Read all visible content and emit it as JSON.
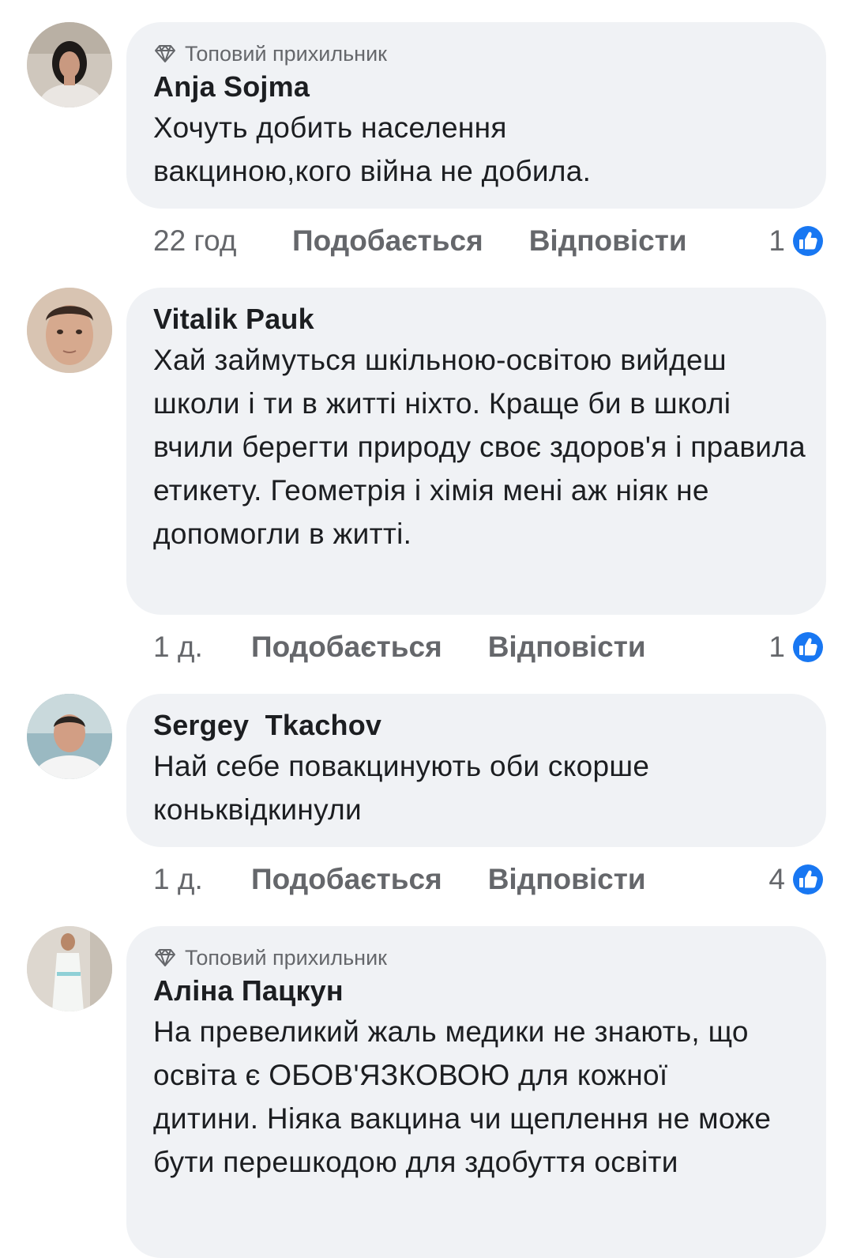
{
  "comments": [
    {
      "badge": "Топовий прихильник",
      "author": "Anja Sojma",
      "text": "Хочуть добить населення вакциною,кого війна не добила.",
      "time": "22 год",
      "like_label": "Подобається",
      "reply_label": "Відповісти",
      "reactions": "1"
    },
    {
      "badge": "",
      "author": "Vitalik Pauk",
      "text": "Хай займуться шкільною-освітою вийдеш школи і ти в житті ніхто. Краще би в школі вчили берегти природу своє здоров'я і правила етикету. Геометрія і хімія мені аж ніяк не допомогли в житті.",
      "time": "1 д.",
      "like_label": "Подобається",
      "reply_label": "Відповісти",
      "reactions": "1"
    },
    {
      "badge": "",
      "author": "Sergey  Tkachov",
      "text": "Най себе повакцинують оби скорше коньквідкинули",
      "time": "1 д.",
      "like_label": "Подобається",
      "reply_label": "Відповісти",
      "reactions": "4"
    },
    {
      "badge": "Топовий прихильник",
      "author": "Аліна Пацкун",
      "text": "На превеликий жаль медики не знають, що освіта є ОБОВ'ЯЗКОВОЮ для кожної дитини. Ніяка вакцина чи щеплення не може бути перешкодою для здобуття освіти",
      "time": "",
      "like_label": "",
      "reply_label": "",
      "reactions": ""
    }
  ],
  "colors": {
    "bubble": "#f0f2f5",
    "secondary_text": "#65676b",
    "like_blue": "#1877f2"
  },
  "icons": {
    "badge": "diamond-icon",
    "reaction": "like-thumb-icon"
  }
}
